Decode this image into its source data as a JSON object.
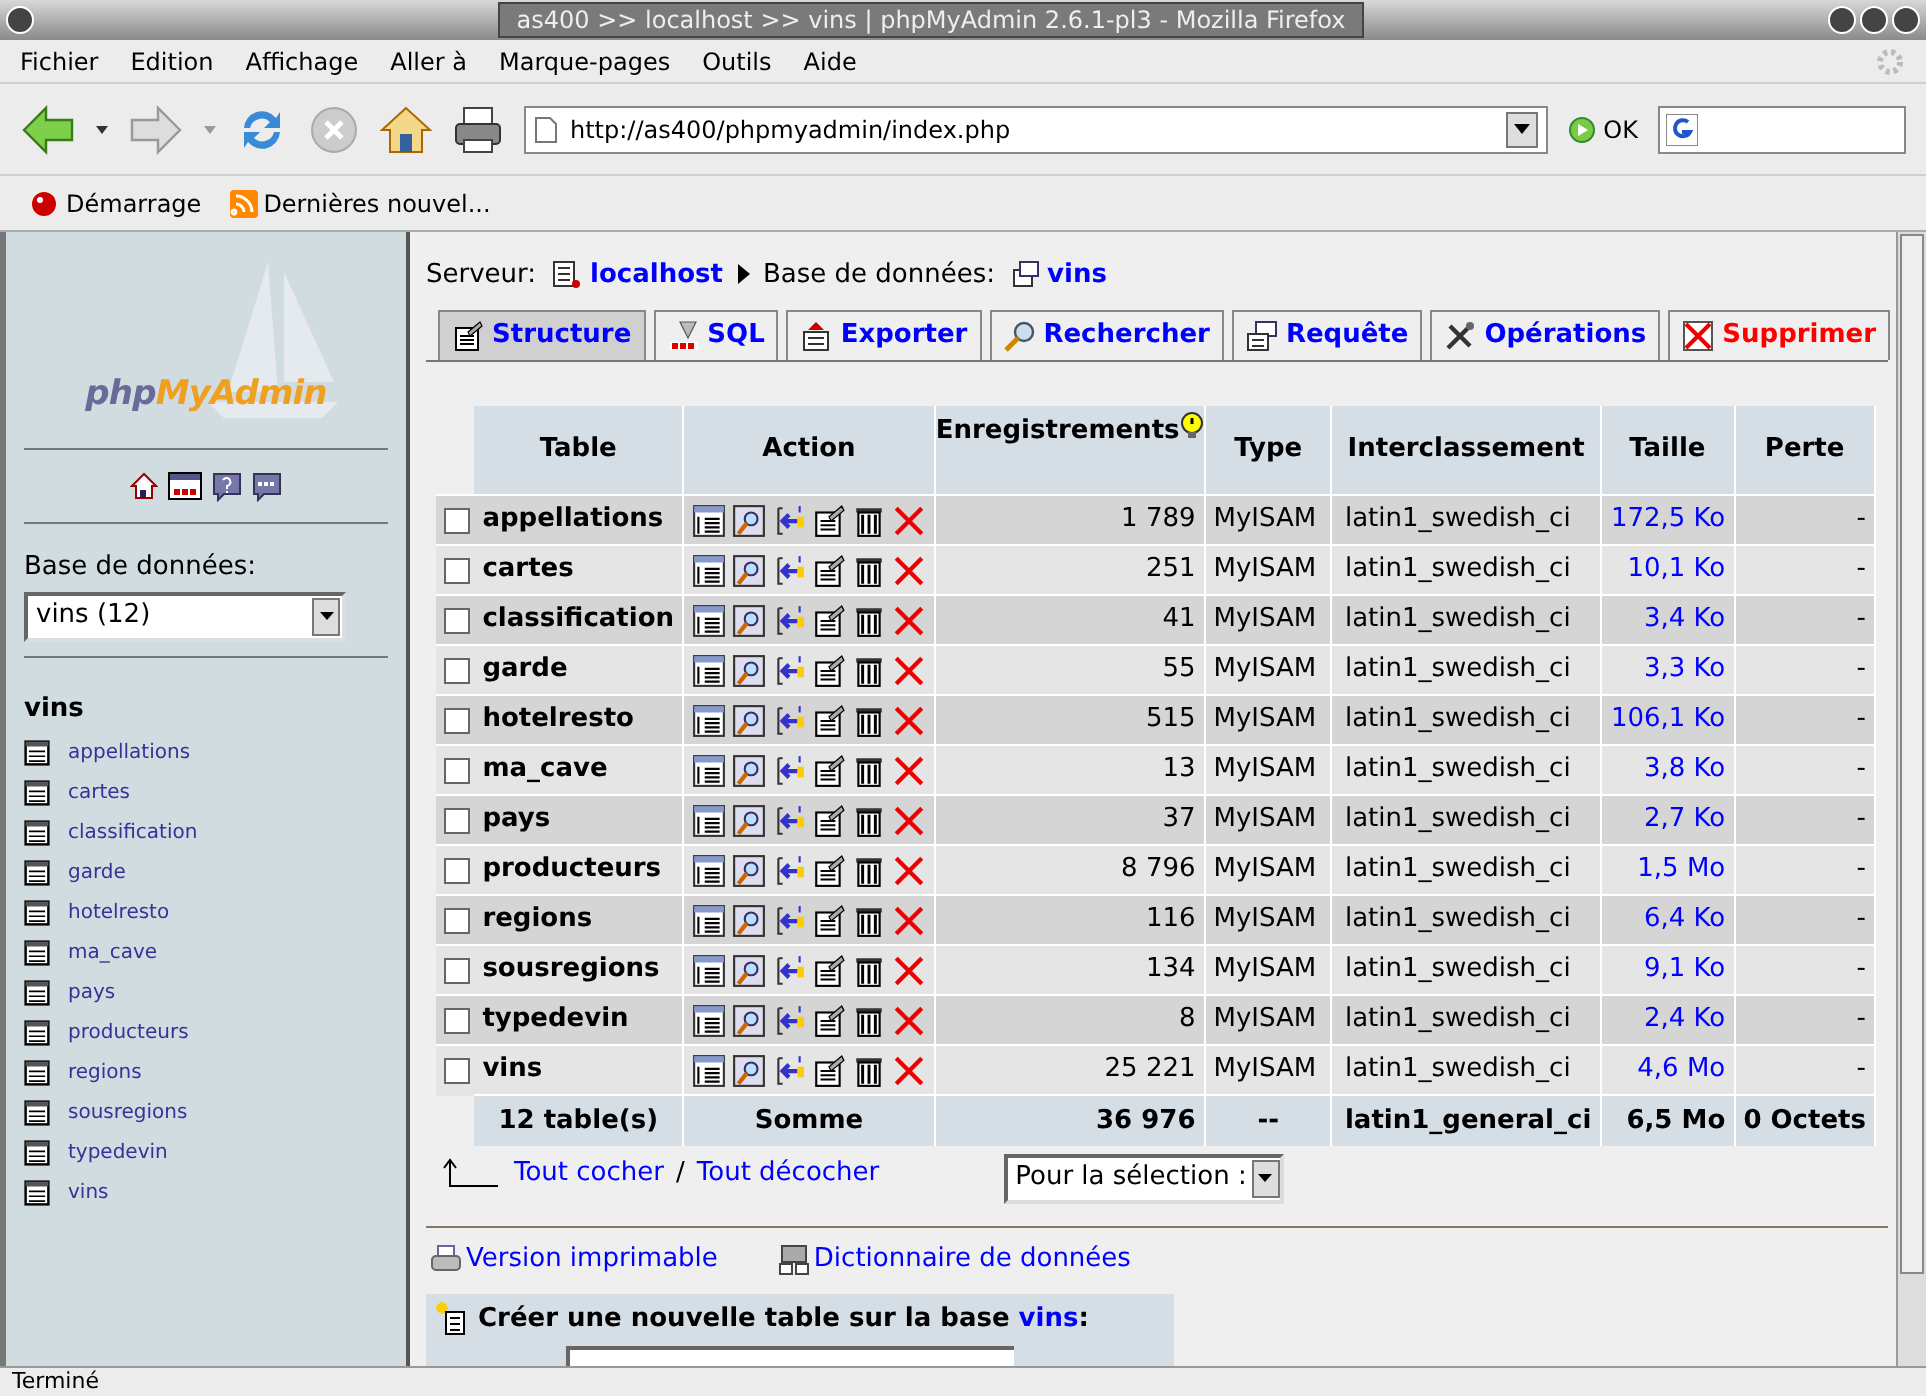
{
  "window": {
    "title": "as400 >> localhost >> vins | phpMyAdmin 2.6.1-pl3 - Mozilla Firefox"
  },
  "menu": [
    "Fichier",
    "Edition",
    "Affichage",
    "Aller à",
    "Marque-pages",
    "Outils",
    "Aide"
  ],
  "navigation": {
    "url": "http://as400/phpmyadmin/index.php",
    "go_button": "OK"
  },
  "bookmarks": [
    "Démarrage",
    "Dernières nouvel..."
  ],
  "sidebar": {
    "logo": [
      "php",
      "MyAdmin"
    ],
    "database_label": "Base de données:",
    "database_select": "vins (12)",
    "database": "vins",
    "tables": [
      "appellations",
      "cartes",
      "classification",
      "garde",
      "hotelresto",
      "ma_cave",
      "pays",
      "producteurs",
      "regions",
      "sousregions",
      "typedevin",
      "vins"
    ]
  },
  "breadcrumb": {
    "server_label": "Serveur:",
    "server": "localhost",
    "database_label": "Base de données:",
    "database": "vins"
  },
  "tabs": [
    {
      "label": "Structure",
      "selected": true,
      "kind": "structure"
    },
    {
      "label": "SQL",
      "selected": false,
      "kind": "sql"
    },
    {
      "label": "Exporter",
      "selected": false,
      "kind": "export"
    },
    {
      "label": "Rechercher",
      "selected": false,
      "kind": "search"
    },
    {
      "label": "Requête",
      "selected": false,
      "kind": "query"
    },
    {
      "label": "Opérations",
      "selected": false,
      "kind": "operations"
    },
    {
      "label": "Supprimer",
      "selected": false,
      "kind": "drop"
    }
  ],
  "table": {
    "columns": [
      "Table",
      "Action",
      "Enregistrements",
      "Type",
      "Interclassement",
      "Taille",
      "Perte"
    ],
    "rows": [
      {
        "name": "appellations",
        "records": "1 789",
        "type": "MyISAM",
        "collation": "latin1_swedish_ci",
        "size": "172,5 Ko",
        "loss": "-",
        "checked": false
      },
      {
        "name": "cartes",
        "records": "251",
        "type": "MyISAM",
        "collation": "latin1_swedish_ci",
        "size": "10,1 Ko",
        "loss": "-",
        "checked": false
      },
      {
        "name": "classification",
        "records": "41",
        "type": "MyISAM",
        "collation": "latin1_swedish_ci",
        "size": "3,4 Ko",
        "loss": "-",
        "checked": false
      },
      {
        "name": "garde",
        "records": "55",
        "type": "MyISAM",
        "collation": "latin1_swedish_ci",
        "size": "3,3 Ko",
        "loss": "-",
        "checked": false
      },
      {
        "name": "hotelresto",
        "records": "515",
        "type": "MyISAM",
        "collation": "latin1_swedish_ci",
        "size": "106,1 Ko",
        "loss": "-",
        "checked": false
      },
      {
        "name": "ma_cave",
        "records": "13",
        "type": "MyISAM",
        "collation": "latin1_swedish_ci",
        "size": "3,8 Ko",
        "loss": "-",
        "checked": false
      },
      {
        "name": "pays",
        "records": "37",
        "type": "MyISAM",
        "collation": "latin1_swedish_ci",
        "size": "2,7 Ko",
        "loss": "-",
        "checked": false
      },
      {
        "name": "producteurs",
        "records": "8 796",
        "type": "MyISAM",
        "collation": "latin1_swedish_ci",
        "size": "1,5 Mo",
        "loss": "-",
        "checked": false
      },
      {
        "name": "regions",
        "records": "116",
        "type": "MyISAM",
        "collation": "latin1_swedish_ci",
        "size": "6,4 Ko",
        "loss": "-",
        "checked": false
      },
      {
        "name": "sousregions",
        "records": "134",
        "type": "MyISAM",
        "collation": "latin1_swedish_ci",
        "size": "9,1 Ko",
        "loss": "-",
        "checked": false
      },
      {
        "name": "typedevin",
        "records": "8",
        "type": "MyISAM",
        "collation": "latin1_swedish_ci",
        "size": "2,4 Ko",
        "loss": "-",
        "checked": false
      },
      {
        "name": "vins",
        "records": "25 221",
        "type": "MyISAM",
        "collation": "latin1_swedish_ci",
        "size": "4,6 Mo",
        "loss": "-",
        "checked": false
      }
    ],
    "footer": {
      "count": "12 table(s)",
      "label": "Somme",
      "records": "36 976",
      "type": "--",
      "collation": "latin1_general_ci",
      "size": "6,5 Mo",
      "loss": "0 Octets"
    }
  },
  "check_all": "Tout cocher",
  "separator": "/",
  "uncheck_all": "Tout décocher",
  "selection_select": "Pour la sélection :",
  "links": [
    "Version imprimable",
    "Dictionnaire de données"
  ],
  "create_table": {
    "text": "Créer une nouvelle table sur la base ",
    "database": "vins",
    "suffix": ":"
  },
  "status_bar": "Terminé"
}
